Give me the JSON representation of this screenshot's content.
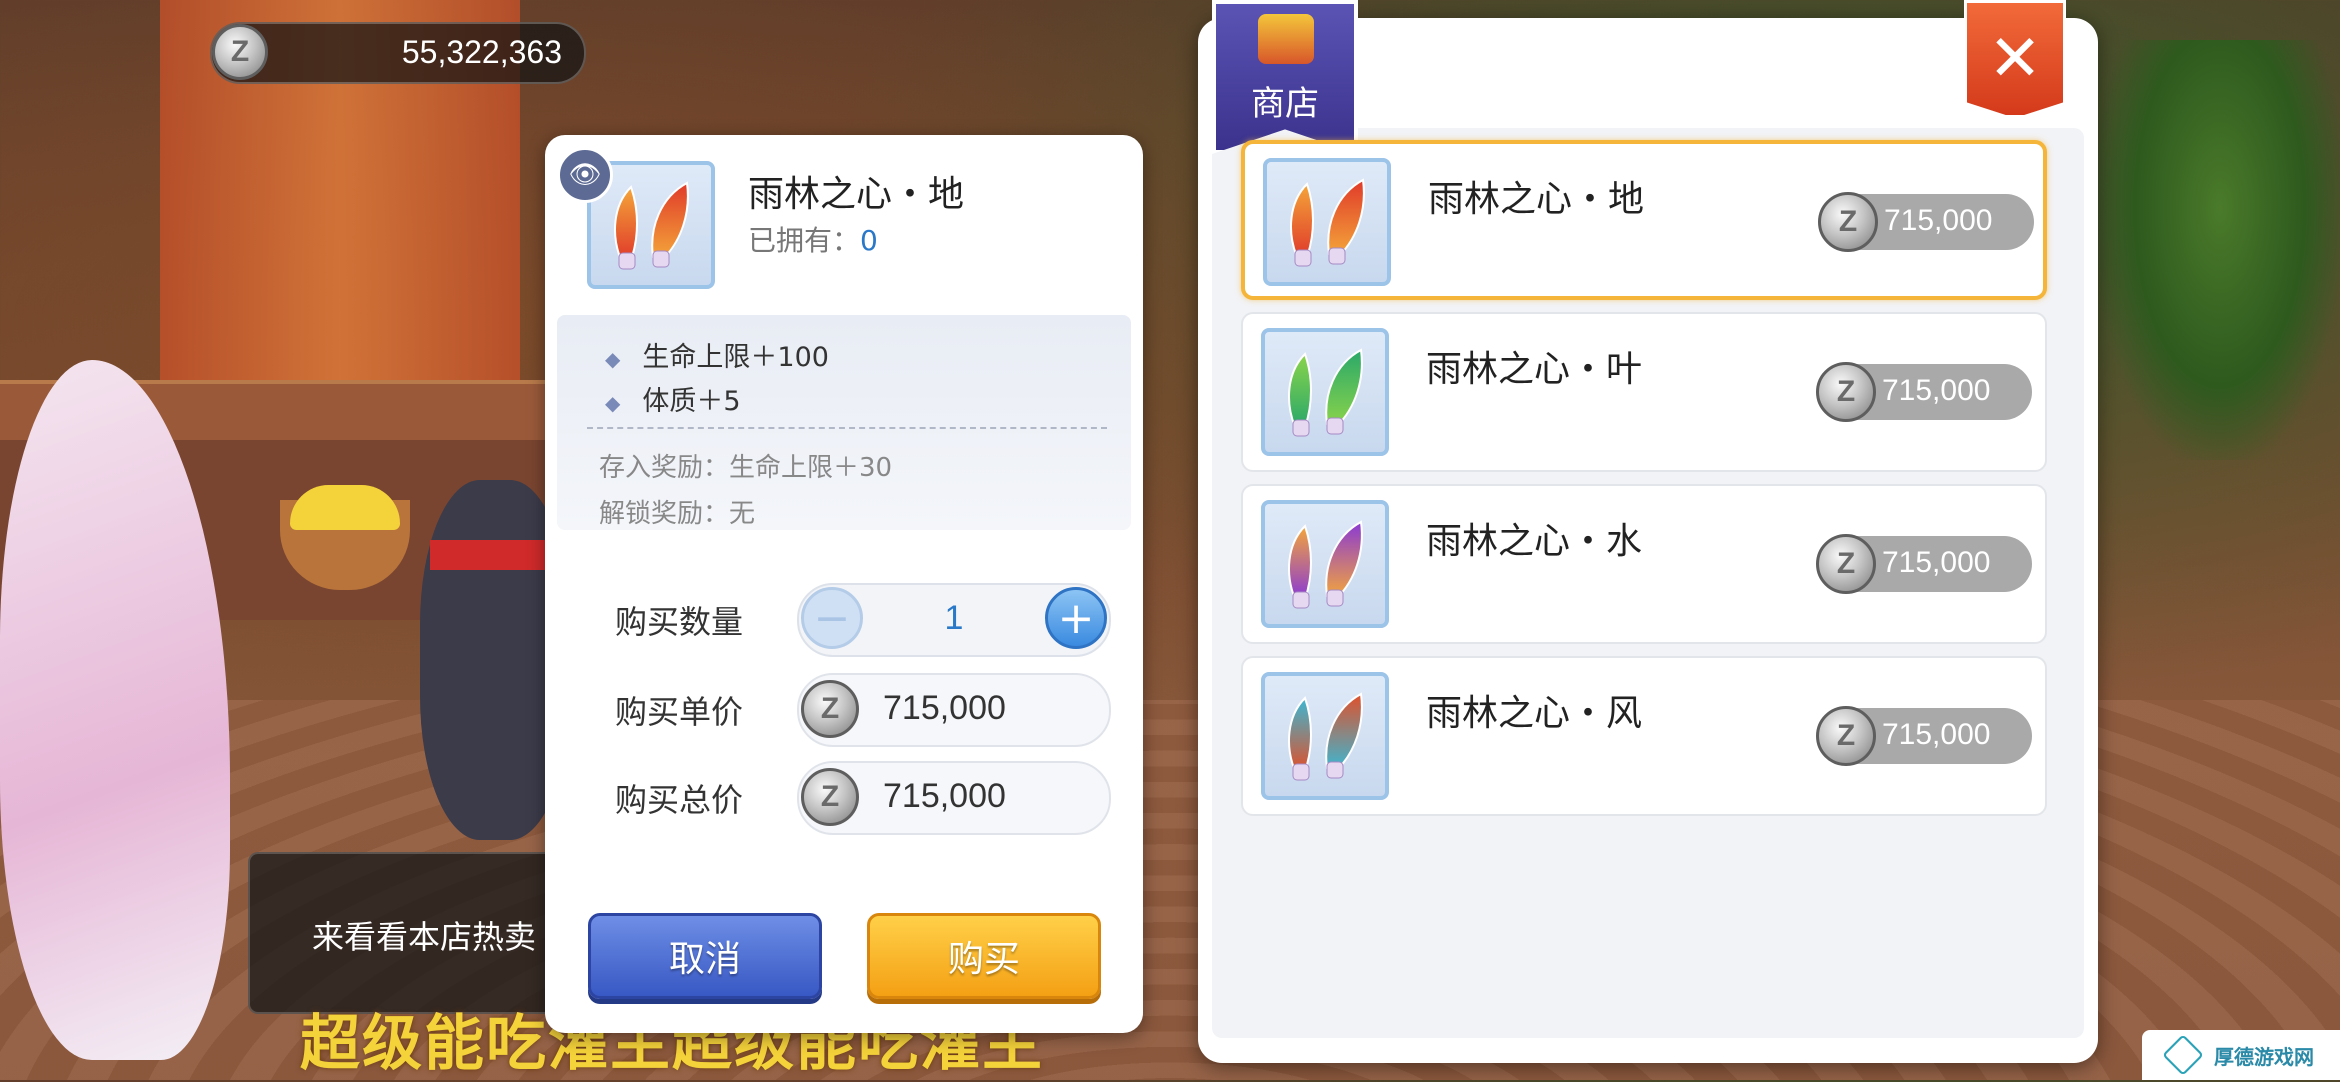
{
  "currency": {
    "amount": "55,322,363",
    "coin_symbol": "Z",
    "icon": "zeny-coin-icon"
  },
  "hint": {
    "text": "来看看本店热卖",
    "banner": "超级能吃灌主超级能吃灌主"
  },
  "detail": {
    "item_name": "雨林之心・地",
    "owned_label": "已拥有：",
    "owned_count": "0",
    "stats": [
      "生命上限＋100",
      "体质＋5"
    ],
    "deposit_reward": "存入奖励：生命上限＋30",
    "unlock_reward": "解锁奖励：无",
    "quantity_label": "购买数量",
    "quantity": "1",
    "minus_symbol": "−",
    "plus_symbol": "+",
    "unit_price_label": "购买单价",
    "unit_price": "715,000",
    "total_price_label": "购买总价",
    "total_price": "715,000",
    "cancel_label": "取消",
    "buy_label": "购买",
    "feather_colors": [
      "#e03a2a",
      "#f4a63a"
    ]
  },
  "shop": {
    "title": "商店",
    "close_symbol": "✕",
    "items": [
      {
        "name": "雨林之心・地",
        "price": "715,000",
        "colors": [
          "#e03a2a",
          "#f4a63a"
        ],
        "selected": true
      },
      {
        "name": "雨林之心・叶",
        "price": "715,000",
        "colors": [
          "#2aa86a",
          "#8ad44a"
        ],
        "selected": false
      },
      {
        "name": "雨林之心・水",
        "price": "715,000",
        "colors": [
          "#8a3ad4",
          "#f4a63a"
        ],
        "selected": false
      },
      {
        "name": "雨林之心・风",
        "price": "715,000",
        "colors": [
          "#e0502a",
          "#3ab8d4"
        ],
        "selected": false
      }
    ]
  },
  "watermark": {
    "text": "厚德游戏网"
  }
}
